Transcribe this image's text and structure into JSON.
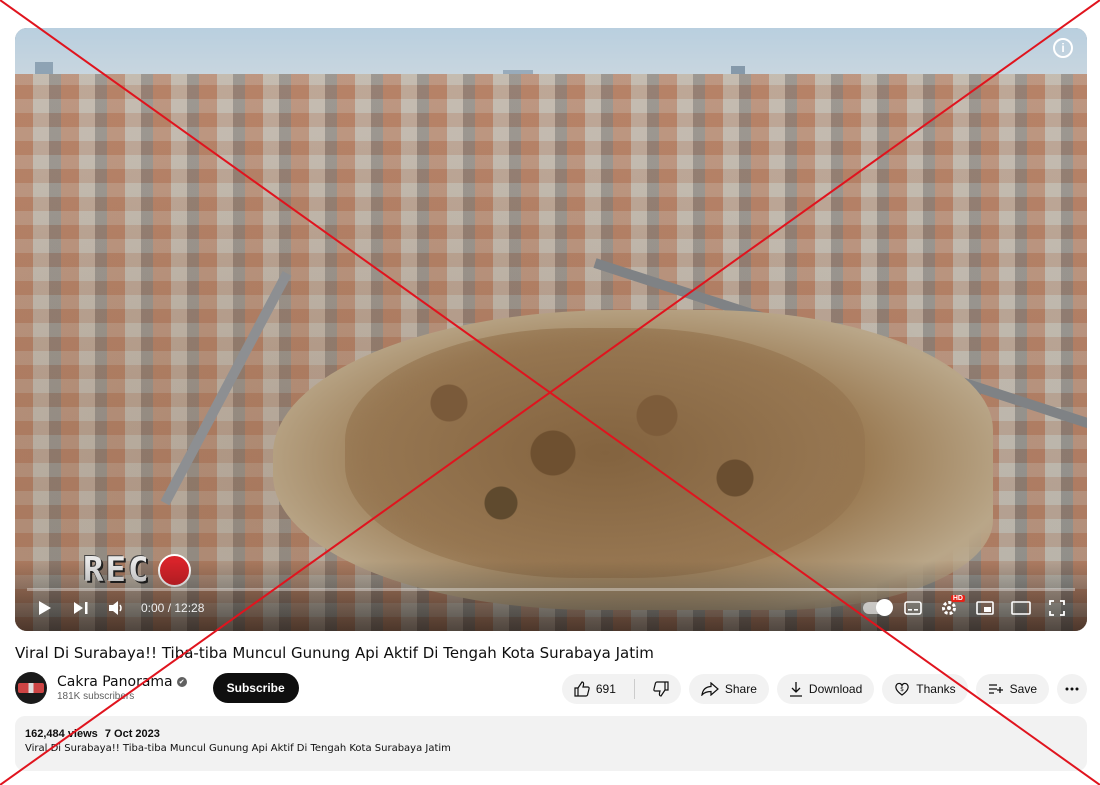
{
  "video": {
    "title": "Viral Di Surabaya!! Tiba-tiba Muncul Gunung Api Aktif Di Tengah Kota Surabaya Jatim",
    "overlay_text": "REC",
    "time": "0:00 / 12:28",
    "progress_fraction": 0.0,
    "hd_badge": "HD",
    "info_icon": "i"
  },
  "channel": {
    "name": "Cakra Panorama",
    "subscribers": "181K subscribers",
    "verified_icon": "✔",
    "subscribe_label": "Subscribe"
  },
  "actions": {
    "likes": "691",
    "share": "Share",
    "download": "Download",
    "thanks": "Thanks",
    "save": "Save"
  },
  "description": {
    "views": "162,484 views",
    "date": "7 Oct 2023",
    "text": "Viral Di Surabaya!! Tiba-tiba Muncul Gunung Api Aktif Di Tengah Kota Surabaya Jatim"
  },
  "colors": {
    "subscribe_bg": "#0f0f0f",
    "pill_bg": "#f2f2f2",
    "cross": "#e0141e",
    "rec_dot": "#d8232a"
  },
  "icons": [
    "play-icon",
    "next-icon",
    "volume-icon",
    "autoplay-toggle-icon",
    "subtitles-icon",
    "settings-icon",
    "miniplayer-icon",
    "theater-icon",
    "fullscreen-icon",
    "like-icon",
    "dislike-icon",
    "share-icon",
    "download-icon",
    "thanks-icon",
    "save-icon",
    "more-icon",
    "info-icon",
    "verified-icon"
  ]
}
